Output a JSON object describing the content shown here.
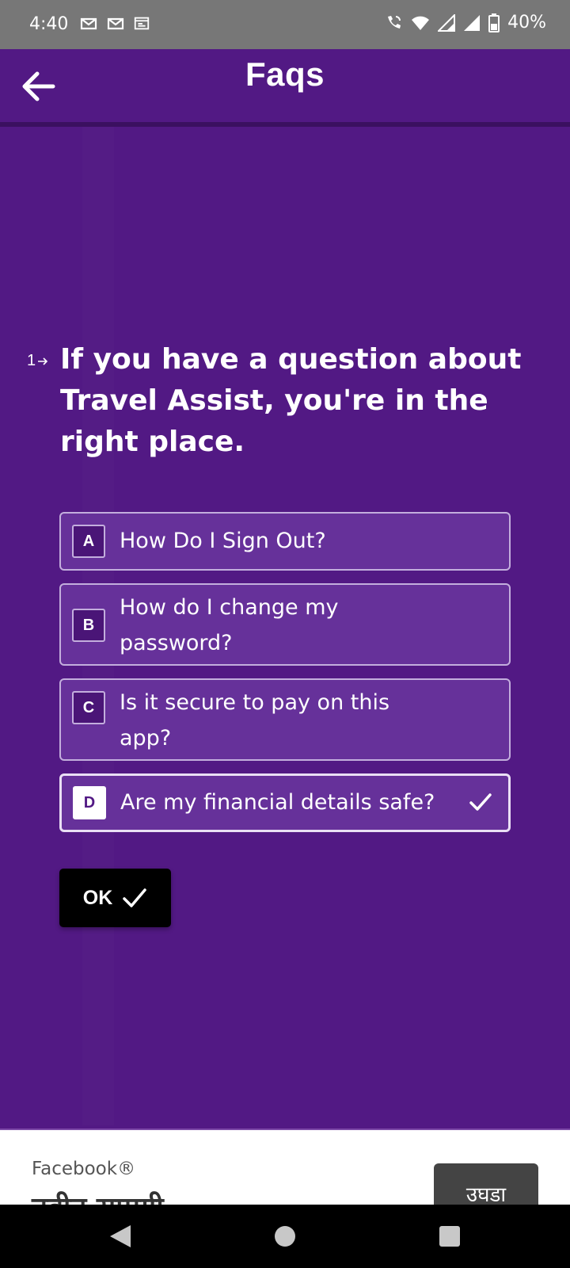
{
  "status_bar": {
    "time": "4:40",
    "battery": "40%",
    "left_icons": [
      "gmail-icon",
      "gmail-icon",
      "calendar-icon"
    ],
    "right_icons": [
      "wifi-calling-icon",
      "wifi-icon",
      "signal-icon",
      "signal-icon",
      "battery-icon"
    ]
  },
  "header": {
    "title": "Faqs",
    "back_icon": "arrow-left-icon"
  },
  "question": {
    "number": "1",
    "text": "If you have a question about Travel Assist, you're in the right place."
  },
  "options": [
    {
      "key": "A",
      "label": "How Do I Sign Out?",
      "selected": false
    },
    {
      "key": "B",
      "label": "How do I change my password?",
      "selected": false
    },
    {
      "key": "C",
      "label": "Is it secure to pay on this app?",
      "selected": false
    },
    {
      "key": "D",
      "label": "Are my financial details safe?",
      "selected": true
    }
  ],
  "ok_button": {
    "label": "OK",
    "icon": "check-icon"
  },
  "ad": {
    "brand": "Facebook®",
    "headline": "नवीन सामग्री",
    "cta": "उघडा"
  },
  "colors": {
    "background": "#521984",
    "option_bg": "#66319a",
    "option_border": "#c3aedd",
    "button_bg": "#000000"
  }
}
